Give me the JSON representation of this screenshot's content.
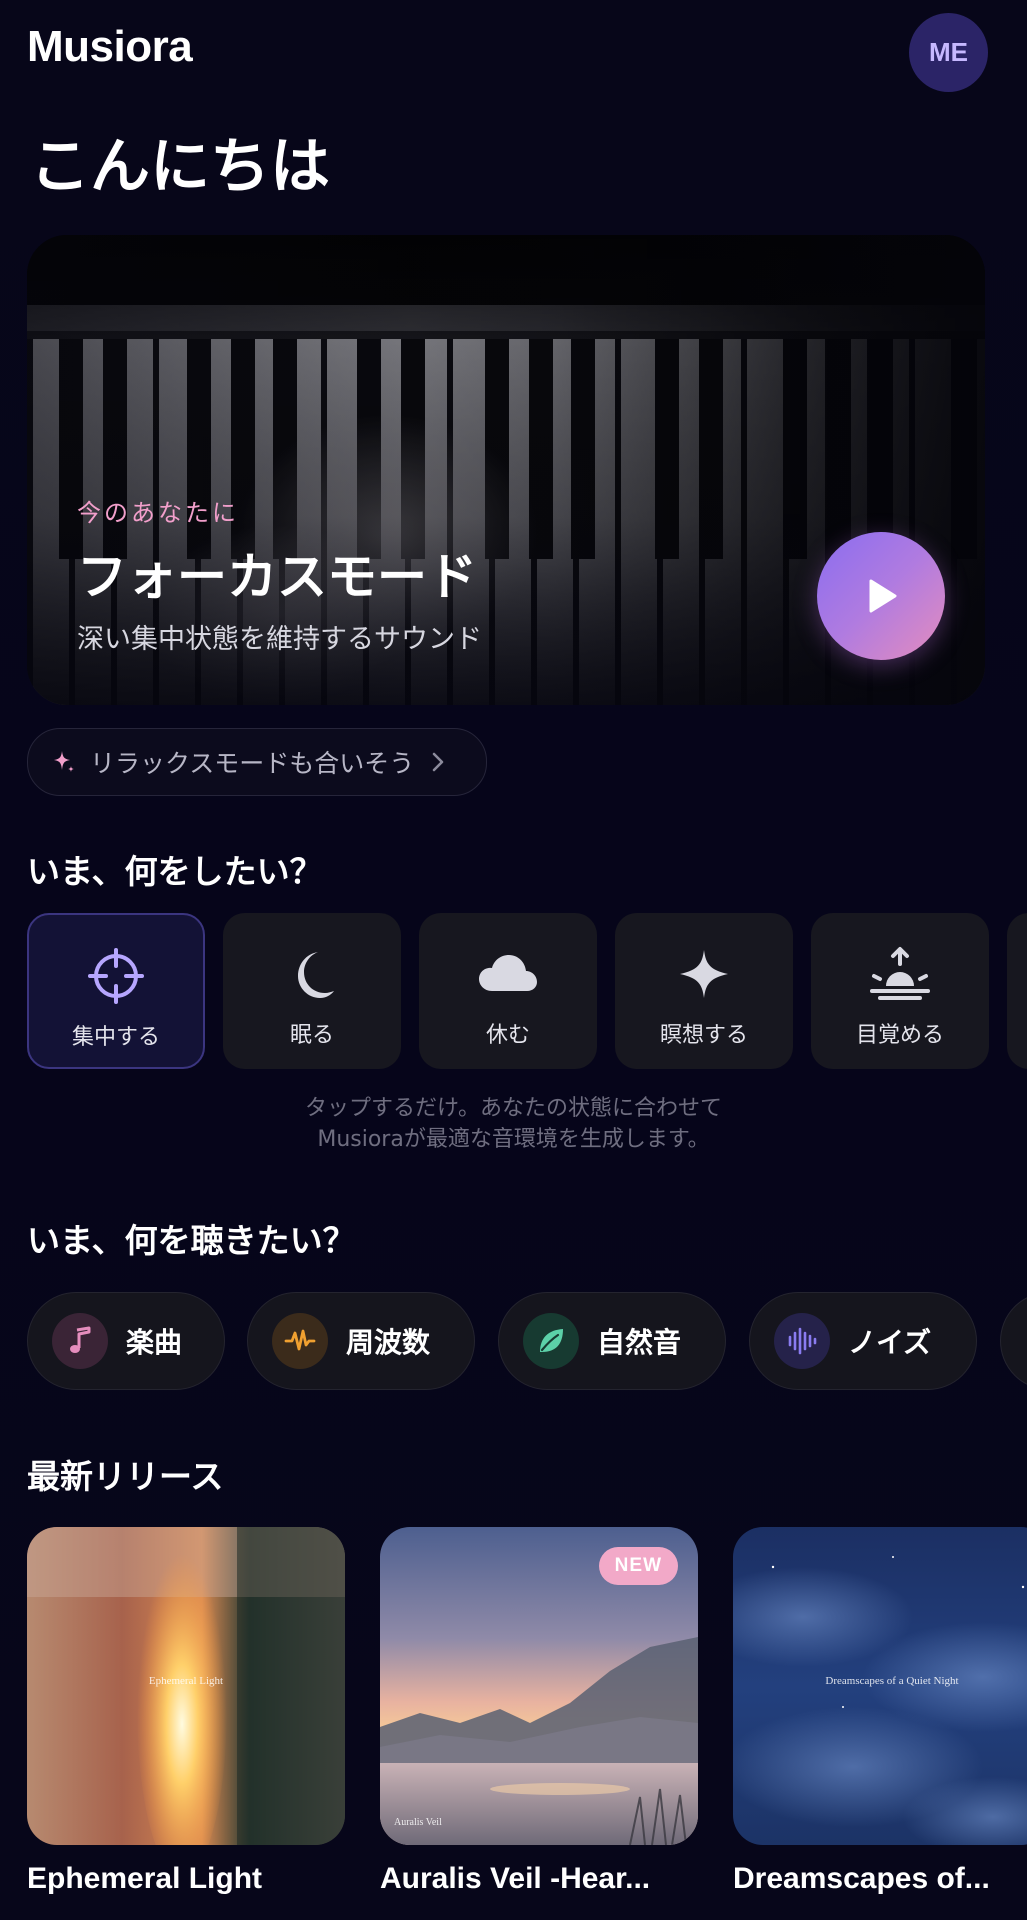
{
  "header": {
    "app_name": "Musiora",
    "avatar_initials": "ME"
  },
  "greeting": "こんにちは",
  "hero": {
    "kicker": "今のあなたに",
    "title": "フォーカスモード",
    "subtitle": "深い集中状態を維持するサウンド",
    "play_icon": "play-icon"
  },
  "suggestion": {
    "icon": "sparkle-icon",
    "label": "リラックスモードも合いそう"
  },
  "mood_section": {
    "heading": "いま、何をしたい？",
    "items": [
      {
        "label": "集中する",
        "icon": "crosshair-icon",
        "selected": true
      },
      {
        "label": "眠る",
        "icon": "moon-icon",
        "selected": false
      },
      {
        "label": "休む",
        "icon": "cloud-icon",
        "selected": false
      },
      {
        "label": "瞑想する",
        "icon": "sparkle-icon",
        "selected": false
      },
      {
        "label": "目覚める",
        "icon": "sunrise-icon",
        "selected": false
      }
    ],
    "caption_line1": "タップするだけ。あなたの状態に合わせて",
    "caption_line2": "Musioraが最適な音環境を生成します。"
  },
  "listen_section": {
    "heading": "いま、何を聴きたい？",
    "items": [
      {
        "label": "楽曲",
        "icon": "music-note-icon",
        "color": "#e58dbd"
      },
      {
        "label": "周波数",
        "icon": "waveform-icon",
        "color": "#f0a030"
      },
      {
        "label": "自然音",
        "icon": "leaf-icon",
        "color": "#5cd0a8"
      },
      {
        "label": "ノイズ",
        "icon": "sound-bars-icon",
        "color": "#8a7cf0"
      }
    ]
  },
  "releases_section": {
    "heading": "最新リリース",
    "items": [
      {
        "title": "Ephemeral Light",
        "cover_text": "Ephemeral Light",
        "is_new": false
      },
      {
        "title": "Auralis Veil -Hear...",
        "cover_text": "Auralis Veil",
        "is_new": true,
        "badge": "NEW"
      },
      {
        "title": "Dreamscapes of...",
        "cover_text": "Dreamscapes of a Quiet Night",
        "is_new": false
      }
    ]
  },
  "colors": {
    "background": "#07061a",
    "accent_pink": "#f29fcb",
    "accent_purple": "#8a6df0",
    "selected_tile": "#131236"
  }
}
